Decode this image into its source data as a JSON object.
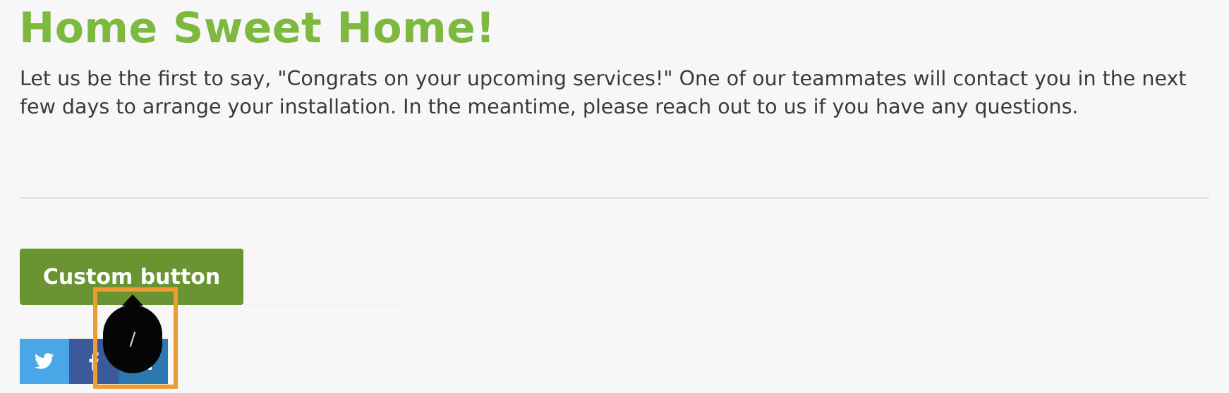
{
  "heading": {
    "title": "Home Sweet Home!"
  },
  "message": {
    "text": "Let us be the first to say, \"Congrats on your upcoming services!\" One of our teammates will contact you in the next few days to arrange your installation. In the meantime, please reach out to us if you have any questions."
  },
  "actions": {
    "custom_button_label": "Custom button"
  },
  "share": {
    "items": [
      {
        "name": "twitter-icon",
        "color": "#4aa7e7"
      },
      {
        "name": "facebook-icon",
        "color": "#3b5a9a"
      },
      {
        "name": "linkedin-icon",
        "color": "#2c78b0"
      }
    ]
  },
  "tooltip": {
    "text": "/"
  },
  "colors": {
    "title": "#7db83f",
    "button": "#6a9331",
    "highlight": "#f09a32",
    "background": "#f7f7f7"
  }
}
